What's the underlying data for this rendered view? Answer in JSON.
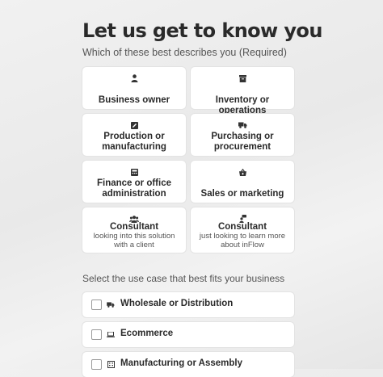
{
  "header": {
    "title": "Let us get to know you",
    "subtitle": "Which of these best describes you (Required)"
  },
  "roles": [
    {
      "label": "Business owner",
      "icon": "person-icon"
    },
    {
      "label": "Inventory or operations",
      "icon": "archive-box-icon"
    },
    {
      "label": "Production or manufacturing",
      "icon": "pencil-square-icon"
    },
    {
      "label": "Purchasing or procurement",
      "icon": "truck-icon"
    },
    {
      "label": "Finance or office administration",
      "icon": "calculator-icon"
    },
    {
      "label": "Sales or marketing",
      "icon": "shopping-basket-icon"
    },
    {
      "label": "Consultant",
      "description": "looking into this solution with a client",
      "icon": "users-icon"
    },
    {
      "label": "Consultant",
      "description": "just looking to learn more about inFlow",
      "icon": "person-chat-icon"
    }
  ],
  "use_case": {
    "label": "Select the use case that best fits your business",
    "options": [
      {
        "label": "Wholesale or Distribution",
        "icon": "truck-icon",
        "checked": false
      },
      {
        "label": "Ecommerce",
        "icon": "laptop-icon",
        "checked": false
      },
      {
        "label": "Manufacturing or Assembly",
        "icon": "building-icon",
        "checked": false
      }
    ]
  }
}
